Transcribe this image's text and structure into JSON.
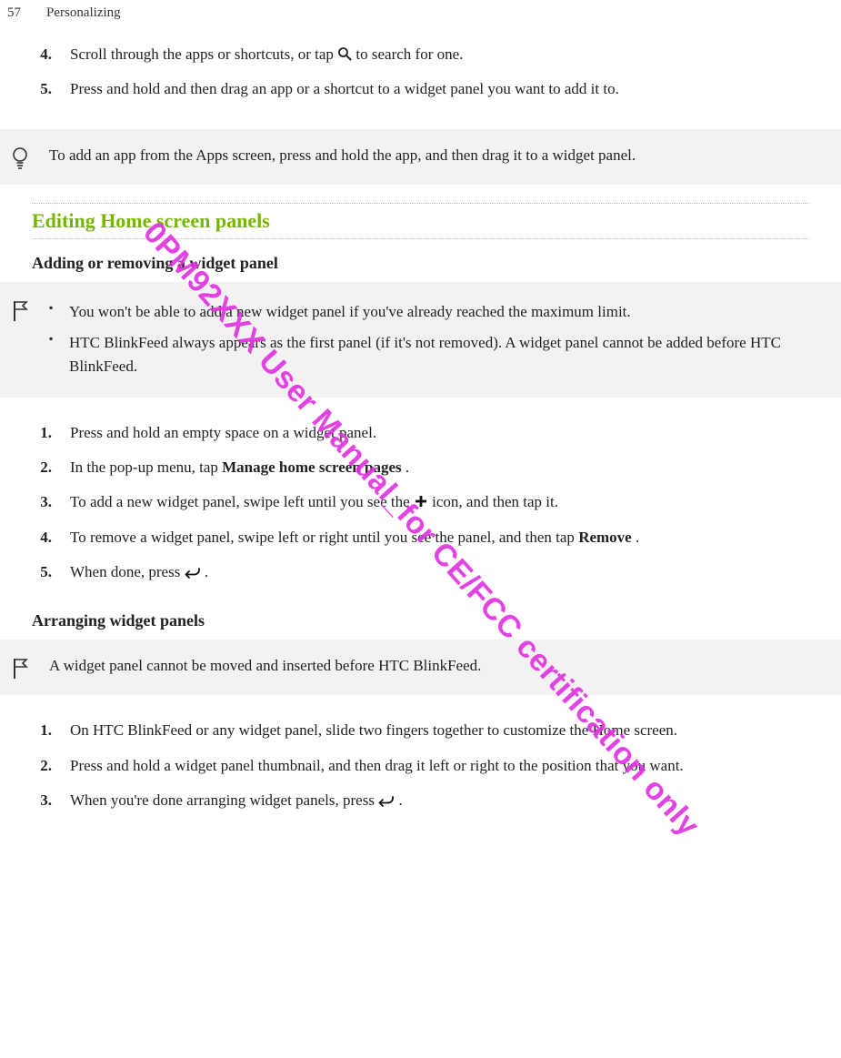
{
  "header": {
    "page_number": "57",
    "chapter": "Personalizing"
  },
  "top_list": {
    "items": [
      {
        "num": "4.",
        "pre": "Scroll through the apps or shortcuts, or tap ",
        "post": " to search for one."
      },
      {
        "num": "5.",
        "text": "Press and hold and then drag an app or a shortcut to a widget panel you want to add it to."
      }
    ]
  },
  "tip1": {
    "text": "To add an app from the Apps screen, press and hold the app, and then drag it to a widget panel."
  },
  "section1": {
    "heading": "Editing Home screen panels",
    "subheading": "Adding or removing a widget panel"
  },
  "note1": {
    "bullets": [
      "You won't be able to add a new widget panel if you've already reached the maximum limit.",
      "HTC BlinkFeed always appears as the first panel (if it's not removed). A widget panel cannot be added before HTC BlinkFeed."
    ]
  },
  "list2": {
    "items": [
      {
        "num": "1.",
        "text": "Press and hold an empty space on a widget panel."
      },
      {
        "num": "2.",
        "pre": "In the pop-up menu, tap ",
        "bold": "Manage home screen pages",
        "post": "."
      },
      {
        "num": "3.",
        "pre": "To add a new widget panel, swipe left until you see the ",
        "post": " icon, and then tap it."
      },
      {
        "num": "4.",
        "pre": "To remove a widget panel, swipe left or right until you see the panel, and then tap ",
        "bold": "Remove",
        "post": "."
      },
      {
        "num": "5.",
        "pre": "When done, press ",
        "post": " ."
      }
    ]
  },
  "subheading2": "Arranging widget panels",
  "note2": {
    "text": "A widget panel cannot be moved and inserted before HTC BlinkFeed."
  },
  "list3": {
    "items": [
      {
        "num": "1.",
        "text": "On HTC BlinkFeed or any widget panel, slide two fingers together to customize the Home screen."
      },
      {
        "num": "2.",
        "text": "Press and hold a widget panel thumbnail, and then drag it left or right to the position that you want."
      },
      {
        "num": "3.",
        "pre": "When you're done arranging widget panels, press ",
        "post": " ."
      }
    ]
  },
  "watermark": "0PM92XXX User Manual_for CE/FCC certification only",
  "colors": {
    "accent": "#74b600",
    "watermark": "#e22fe2"
  }
}
